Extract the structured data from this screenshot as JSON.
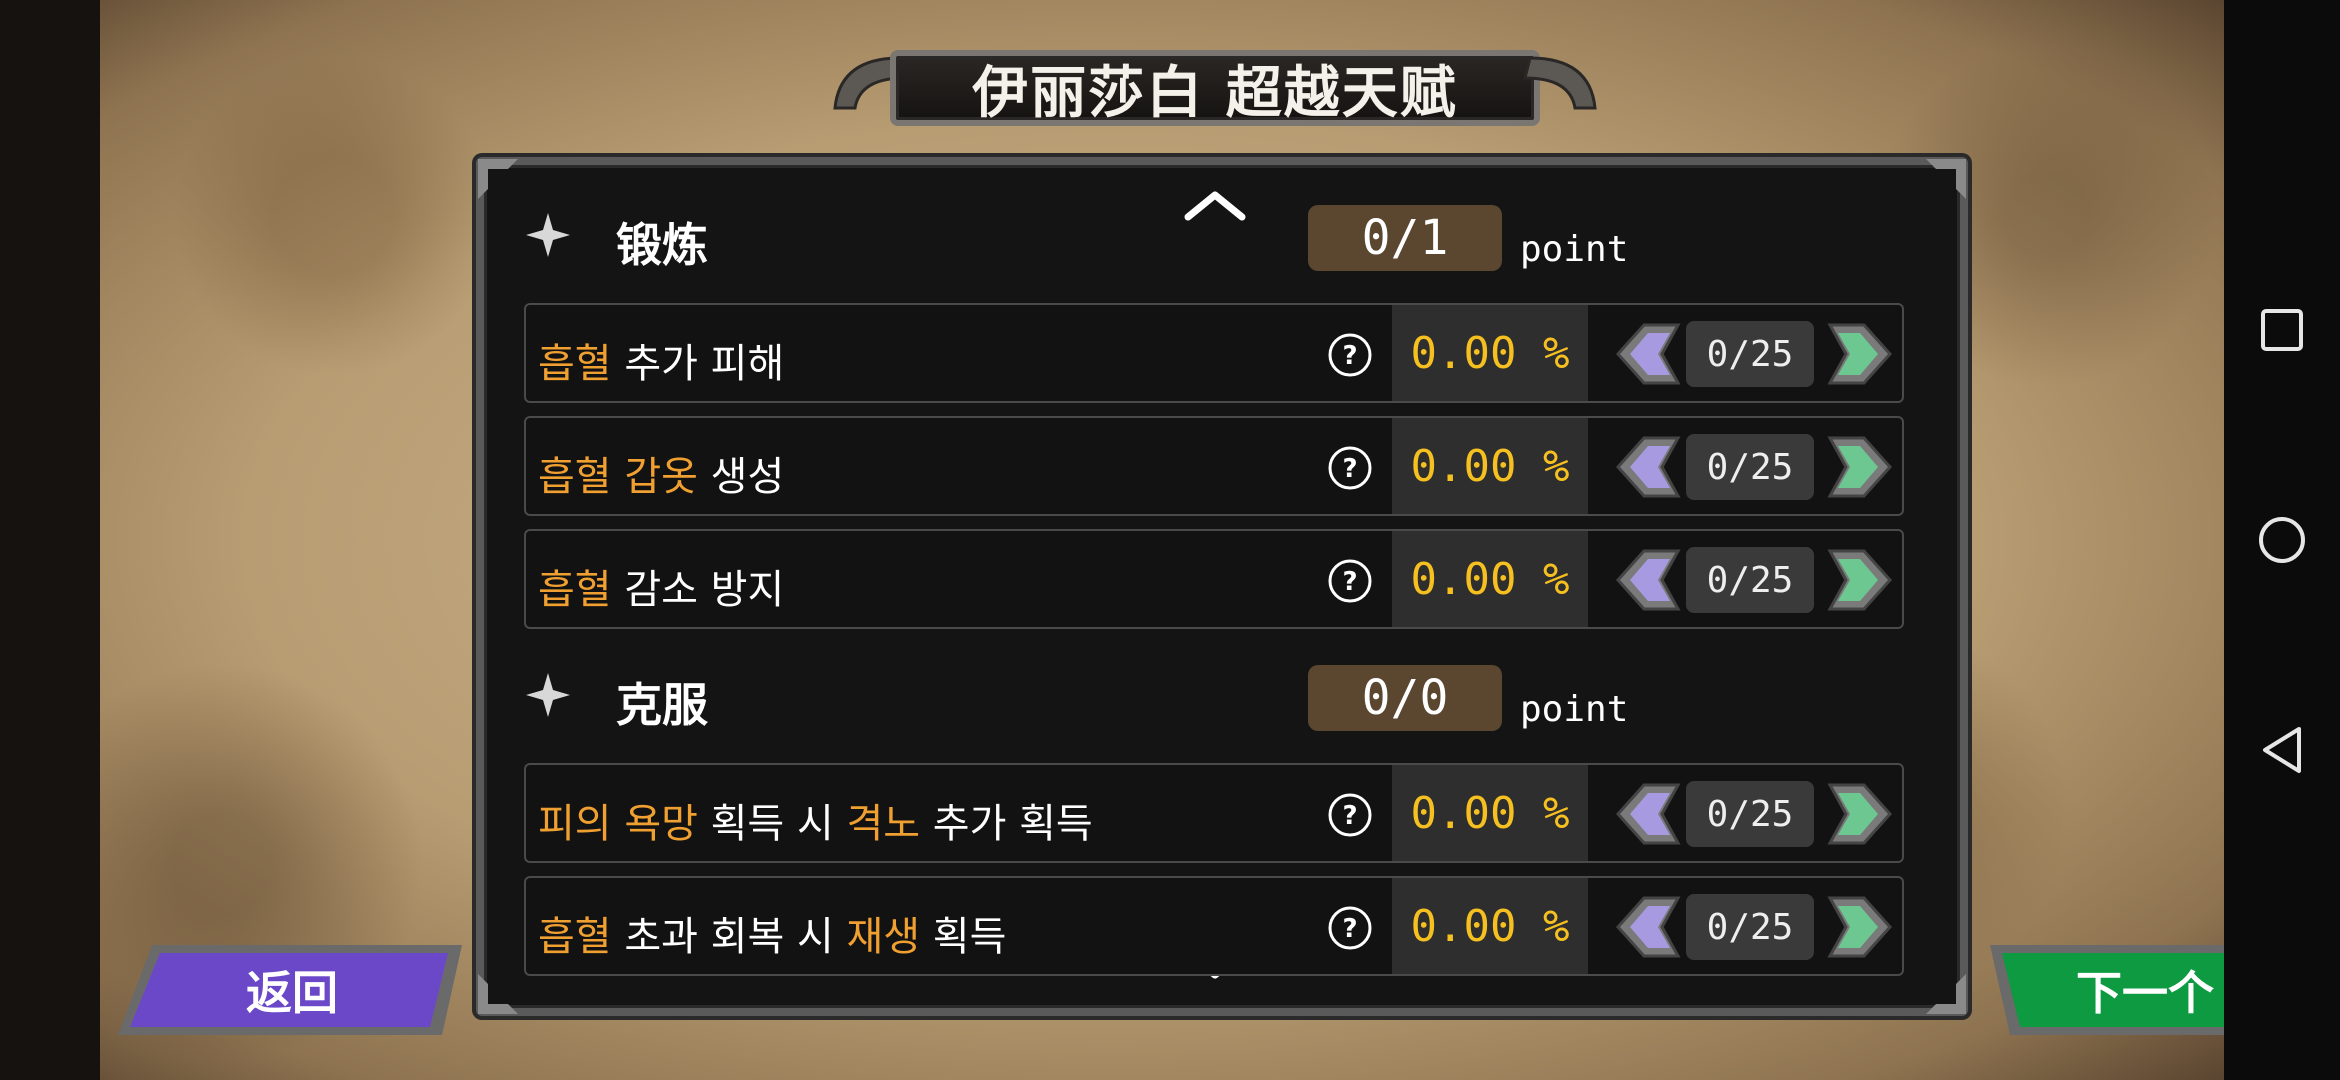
{
  "title": "伊丽莎白 超越天赋",
  "sections": [
    {
      "name": "锻炼",
      "points": "0/1",
      "point_unit": "point",
      "rows": [
        {
          "parts": [
            {
              "t": "흡혈",
              "hl": true
            },
            {
              "t": " 추가 피해",
              "hl": false
            }
          ],
          "value": "0.00 %",
          "level": "0/25"
        },
        {
          "parts": [
            {
              "t": "흡혈",
              "hl": true
            },
            {
              "t": " ",
              "hl": false
            },
            {
              "t": "갑옷",
              "hl": true
            },
            {
              "t": " 생성",
              "hl": false
            }
          ],
          "value": "0.00 %",
          "level": "0/25"
        },
        {
          "parts": [
            {
              "t": "흡혈",
              "hl": true
            },
            {
              "t": " 감소 방지",
              "hl": false
            }
          ],
          "value": "0.00 %",
          "level": "0/25"
        }
      ]
    },
    {
      "name": "克服",
      "points": "0/0",
      "point_unit": "point",
      "rows": [
        {
          "parts": [
            {
              "t": "피의 욕망",
              "hl": true
            },
            {
              "t": " 획득 시 ",
              "hl": false
            },
            {
              "t": "격노",
              "hl": true
            },
            {
              "t": " 추가 획득",
              "hl": false
            }
          ],
          "value": "0.00 %",
          "level": "0/25"
        },
        {
          "parts": [
            {
              "t": "흡혈",
              "hl": true
            },
            {
              "t": " 초과 회복 시 ",
              "hl": false
            },
            {
              "t": "재생",
              "hl": true
            },
            {
              "t": " 획득",
              "hl": false
            }
          ],
          "value": "0.00 %",
          "level": "0/25"
        }
      ]
    }
  ],
  "buttons": {
    "back": "返回",
    "next": "下一个"
  },
  "colors": {
    "highlight": "#f0a030",
    "value": "#f5c020",
    "back_button": "#6a48c8",
    "next_button": "#0d9a40",
    "point_box": "#5b4630"
  },
  "icons": {
    "section": "sparkle-icon",
    "help": "help-circle-icon",
    "decrease": "left-arrow-icon",
    "increase": "right-arrow-icon",
    "scroll_up": "chevron-up-icon",
    "scroll_down": "chevron-down-icon"
  }
}
